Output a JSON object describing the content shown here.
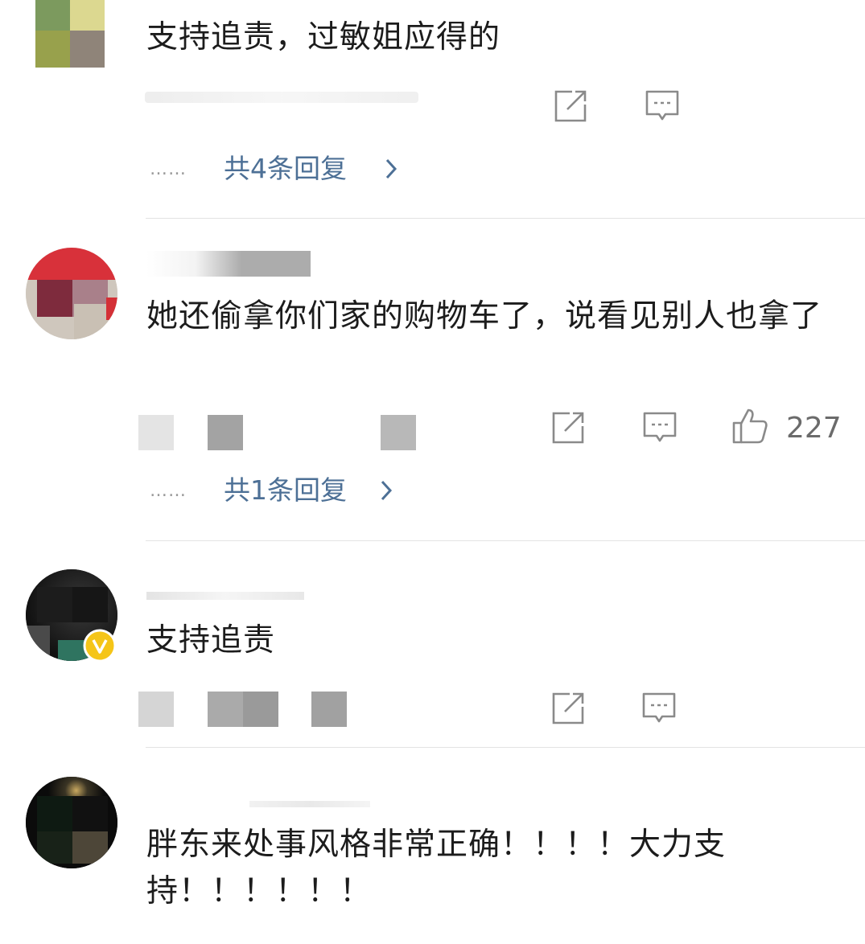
{
  "comments": [
    {
      "text": "支持追责，过敏姐应得的",
      "replies_label": "共4条回复",
      "dots": "……"
    },
    {
      "text": "她还偷拿你们家的购物车了，说看见别人也拿了",
      "likes": "227",
      "replies_label": "共1条回复",
      "dots": "……"
    },
    {
      "text": "支持追责"
    },
    {
      "text": "胖东来处事风格非常正确！！！！大力支持！！！！！！"
    }
  ],
  "icons": {
    "share": "share-icon",
    "comment": "comment-icon",
    "like": "thumbs-up-icon",
    "verified": "verified-v-badge-icon"
  },
  "colors": {
    "link": "#4d7096",
    "verified_badge": "#f5c518",
    "divider": "#e3e3e3"
  }
}
